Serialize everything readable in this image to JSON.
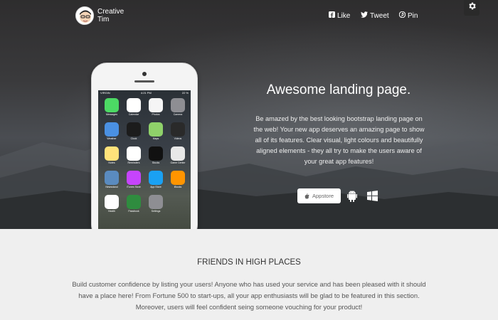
{
  "nav": {
    "brand_line1": "Creative",
    "brand_line2": "Tim",
    "social": [
      {
        "label": "Like",
        "icon": "facebook-icon"
      },
      {
        "label": "Tweet",
        "icon": "twitter-icon"
      },
      {
        "label": "Pin",
        "icon": "pinterest-icon"
      }
    ],
    "settings_icon": "gear-icon"
  },
  "phone": {
    "carrier": "VIRGIN",
    "time": "4:21 PM",
    "battery": "22 %",
    "apps": [
      {
        "label": "Messages",
        "color": "#4cd964"
      },
      {
        "label": "Calendar",
        "color": "#ffffff"
      },
      {
        "label": "Photos",
        "color": "#f5f5f5"
      },
      {
        "label": "Camera",
        "color": "#8e8e93"
      },
      {
        "label": "Weather",
        "color": "#4a90e2"
      },
      {
        "label": "Clock",
        "color": "#1c1c1c"
      },
      {
        "label": "Maps",
        "color": "#8fd16a"
      },
      {
        "label": "Videos",
        "color": "#2a2a2a"
      },
      {
        "label": "Notes",
        "color": "#ffe27a"
      },
      {
        "label": "Reminders",
        "color": "#ffffff"
      },
      {
        "label": "Stocks",
        "color": "#111111"
      },
      {
        "label": "Game Center",
        "color": "#e8e8e8"
      },
      {
        "label": "Newsstand",
        "color": "#5a8bbf"
      },
      {
        "label": "iTunes Store",
        "color": "#c644fc"
      },
      {
        "label": "App Store",
        "color": "#1aa1f3"
      },
      {
        "label": "iBooks",
        "color": "#ff9500"
      },
      {
        "label": "Health",
        "color": "#ffffff"
      },
      {
        "label": "Passbook",
        "color": "#2f8c3f"
      },
      {
        "label": "Settings",
        "color": "#8e8e93"
      }
    ]
  },
  "hero": {
    "title": "Awesome landing page.",
    "description": "Be amazed by the best looking bootstrap landing page on the web! Your new app deserves an amazing page to show all of its features. Clear visual, light colours and beautifully aligned elements - they all try to make the users aware of your great app features!",
    "appstore_label": "Appstore"
  },
  "section": {
    "title": "FRIENDS IN HIGH PLACES",
    "description": "Build customer confidence by listing your users! Anyone who has used your service and has been pleased with it should have a place here! From Fortune 500 to start-ups, all your app enthusiasts will be glad to be featured in this section. Moreover, users will feel confident seing someone vouching for your product!"
  }
}
